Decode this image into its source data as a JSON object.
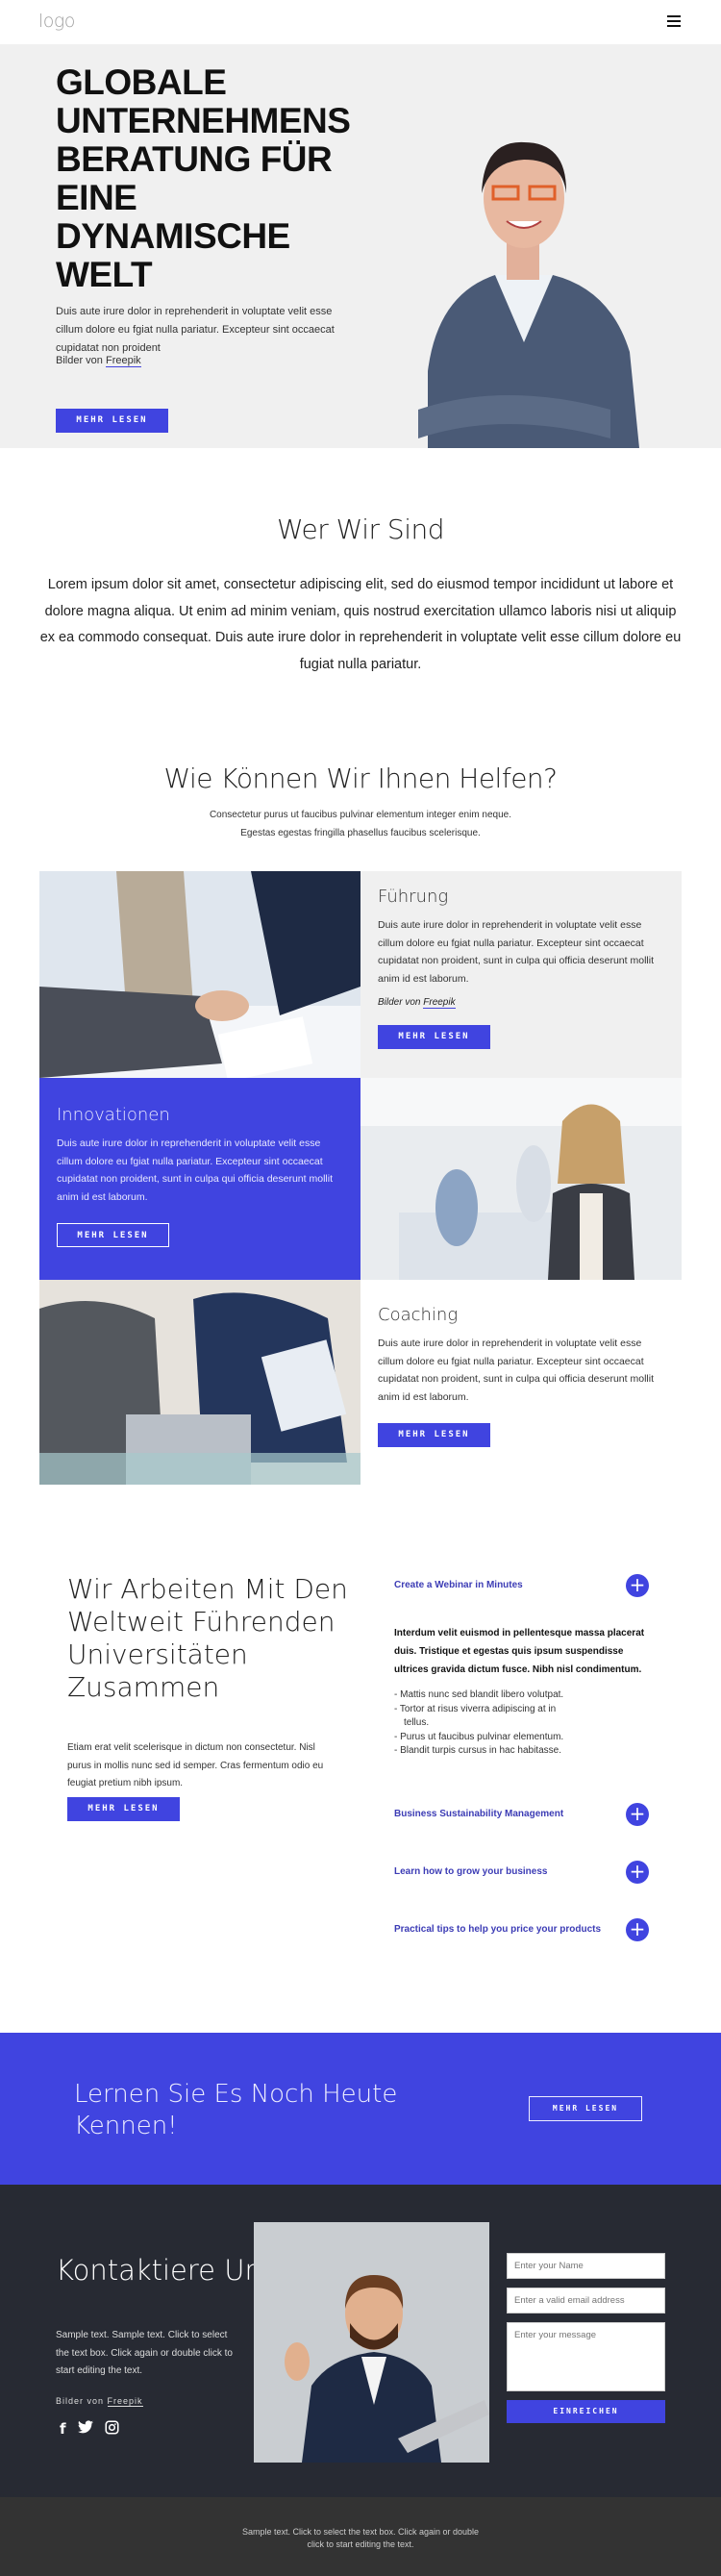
{
  "header": {
    "logo": "logo",
    "menu_icon": "hamburger-icon"
  },
  "hero": {
    "title": "GLOBALE UNTERNEHMENS BERATUNG FÜR EINE DYNAMISCHE WELT",
    "text": "Duis aute irure dolor in reprehenderit in voluptate velit esse cillum dolore eu fgiat nulla pariatur. Excepteur sint occaecat cupidatat non proident",
    "credit_prefix": "Bilder von",
    "credit_link": "Freepik",
    "button": "MEHR LESEN"
  },
  "who": {
    "title": "Wer Wir Sind",
    "text": "Lorem ipsum dolor sit amet, consectetur adipiscing elit, sed do eiusmod tempor incididunt ut labore et dolore magna aliqua. Ut enim ad minim veniam, quis nostrud exercitation ullamco laboris nisi ut aliquip ex ea commodo consequat. Duis aute irure dolor in reprehenderit in voluptate velit esse cillum dolore eu fugiat nulla pariatur."
  },
  "help": {
    "title": "Wie Können Wir Ihnen Helfen?",
    "line1": "Consectetur purus ut faucibus pulvinar elementum integer enim neque.",
    "line2": "Egestas egestas fringilla phasellus faucibus scelerisque."
  },
  "services": [
    {
      "title": "Führung",
      "text": "Duis aute irure dolor in reprehenderit in voluptate velit esse cillum dolore eu fgiat nulla pariatur. Excepteur sint occaecat cupidatat non proident, sunt in culpa qui officia deserunt mollit anim id est laborum.",
      "credit_prefix": "Bilder von",
      "credit_link": "Freepik",
      "button": "MEHR LESEN"
    },
    {
      "title": "Innovationen",
      "text": "Duis aute irure dolor in reprehenderit in voluptate velit esse cillum dolore eu fgiat nulla pariatur. Excepteur sint occaecat cupidatat non proident, sunt in culpa qui officia deserunt mollit anim id est laborum.",
      "button": "MEHR LESEN"
    },
    {
      "title": "Coaching",
      "text": "Duis aute irure dolor in reprehenderit in voluptate velit esse cillum dolore eu fgiat nulla pariatur. Excepteur sint occaecat cupidatat non proident, sunt in culpa qui officia deserunt mollit anim id est laborum.",
      "button": "MEHR LESEN"
    }
  ],
  "universities": {
    "title": "Wir Arbeiten Mit Den Weltweit Führenden Universitäten Zusammen",
    "text": "Etiam erat velit scelerisque in dictum non consectetur. Nisl purus in mollis nunc sed id semper. Cras fermentum odio eu feugiat pretium nibh ipsum.",
    "button": "MEHR LESEN",
    "accordion": [
      {
        "title": "Create a Webinar in Minutes",
        "expanded": true,
        "lead": "Interdum velit euismod in pellentesque massa placerat duis. Tristique et egestas quis ipsum suspendisse ultrices gravida dictum fusce. Nibh nisl condimentum.",
        "bullets": [
          "- Mattis nunc sed blandit libero volutpat.",
          "- Tortor at risus viverra adipiscing at in tellus.",
          "- Purus ut faucibus pulvinar elementum.",
          "- Blandit turpis cursus in hac habitasse."
        ]
      },
      {
        "title": "Business Sustainability Management",
        "expanded": false
      },
      {
        "title": "Learn how to grow your business",
        "expanded": false
      },
      {
        "title": "Practical tips to help you price your products",
        "expanded": false
      }
    ]
  },
  "cta": {
    "title": "Lernen Sie Es Noch Heute Kennen!",
    "button": "MEHR LESEN"
  },
  "contact": {
    "title": "Kontaktiere Uns",
    "text": "Sample text. Sample text. Click to select the text box. Click again or double click to start editing the text.",
    "credit_prefix": "Bilder von",
    "credit_link": "Freepik",
    "social": [
      "f",
      "🐦",
      "◎"
    ],
    "form": {
      "name_placeholder": "Enter your Name",
      "email_placeholder": "Enter a valid email address",
      "message_placeholder": "Enter your message",
      "submit": "EINREICHEN"
    }
  },
  "footer": {
    "text": "Sample text. Click to select the text box. Click again or double click to start editing the text."
  },
  "colors": {
    "accent": "#4044e0",
    "dark": "#272a33",
    "footer": "#333333",
    "light_bg": "#f0f0f0"
  }
}
